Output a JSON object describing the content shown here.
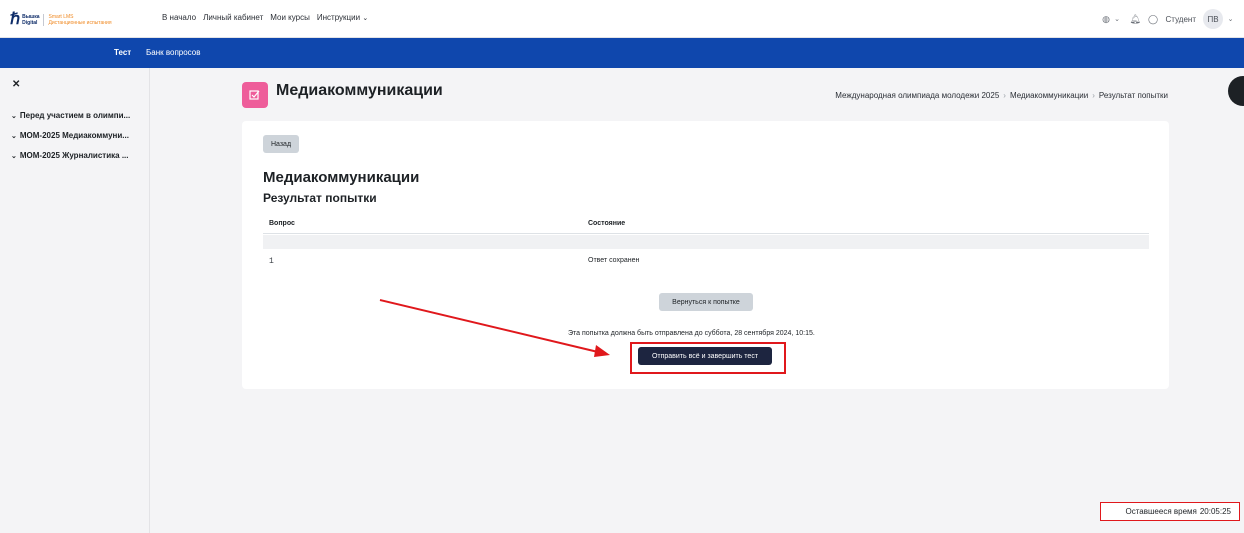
{
  "brand": {
    "mark": "ℏ",
    "line1": "Вышка",
    "line2": "Digital",
    "product1": "Smart LMS",
    "product2": "Дистанционные испытания"
  },
  "topnav": {
    "items": [
      "В начало",
      "Личный кабинет",
      "Мои курсы",
      "Инструкции"
    ],
    "dropdown_icon": "chevron-down-icon"
  },
  "user": {
    "name": "Студент",
    "initials": "ПВ"
  },
  "secondary_nav": {
    "tabs": [
      "Тест",
      "Банк вопросов"
    ],
    "active": "Тест"
  },
  "sidebar": {
    "close_icon": "✕",
    "items": [
      {
        "label": "Перед участием в олимпи..."
      },
      {
        "label": "МОМ-2025 Медиакоммуни..."
      },
      {
        "label": "МОМ-2025 Журналистика ..."
      }
    ]
  },
  "header": {
    "title": "Медиакоммуникации",
    "breadcrumb": [
      "Международная олимпиада молодежи 2025",
      "Медиакоммуникации",
      "Результат попытки"
    ]
  },
  "content": {
    "back_label": "Назад",
    "heading": "Медиакоммуникации",
    "subheading": "Результат попытки",
    "table": {
      "columns": [
        "Вопрос",
        "Состояние"
      ],
      "rows": [
        {
          "question": "1",
          "status": "Ответ сохранен"
        }
      ]
    },
    "return_label": "Вернуться к попытке",
    "deadline_text": "Эта попытка должна быть отправлена до суббота, 28 сентября 2024, 10:15.",
    "submit_label": "Отправить всё и завершить тест"
  },
  "timer": {
    "label": "Оставшееся время",
    "value": "20:05:25"
  },
  "colors": {
    "primary_bar": "#0f47ad",
    "page_icon": "#ee5d9a",
    "submit_button": "#1d2540",
    "annotation_red": "#e0181c"
  }
}
